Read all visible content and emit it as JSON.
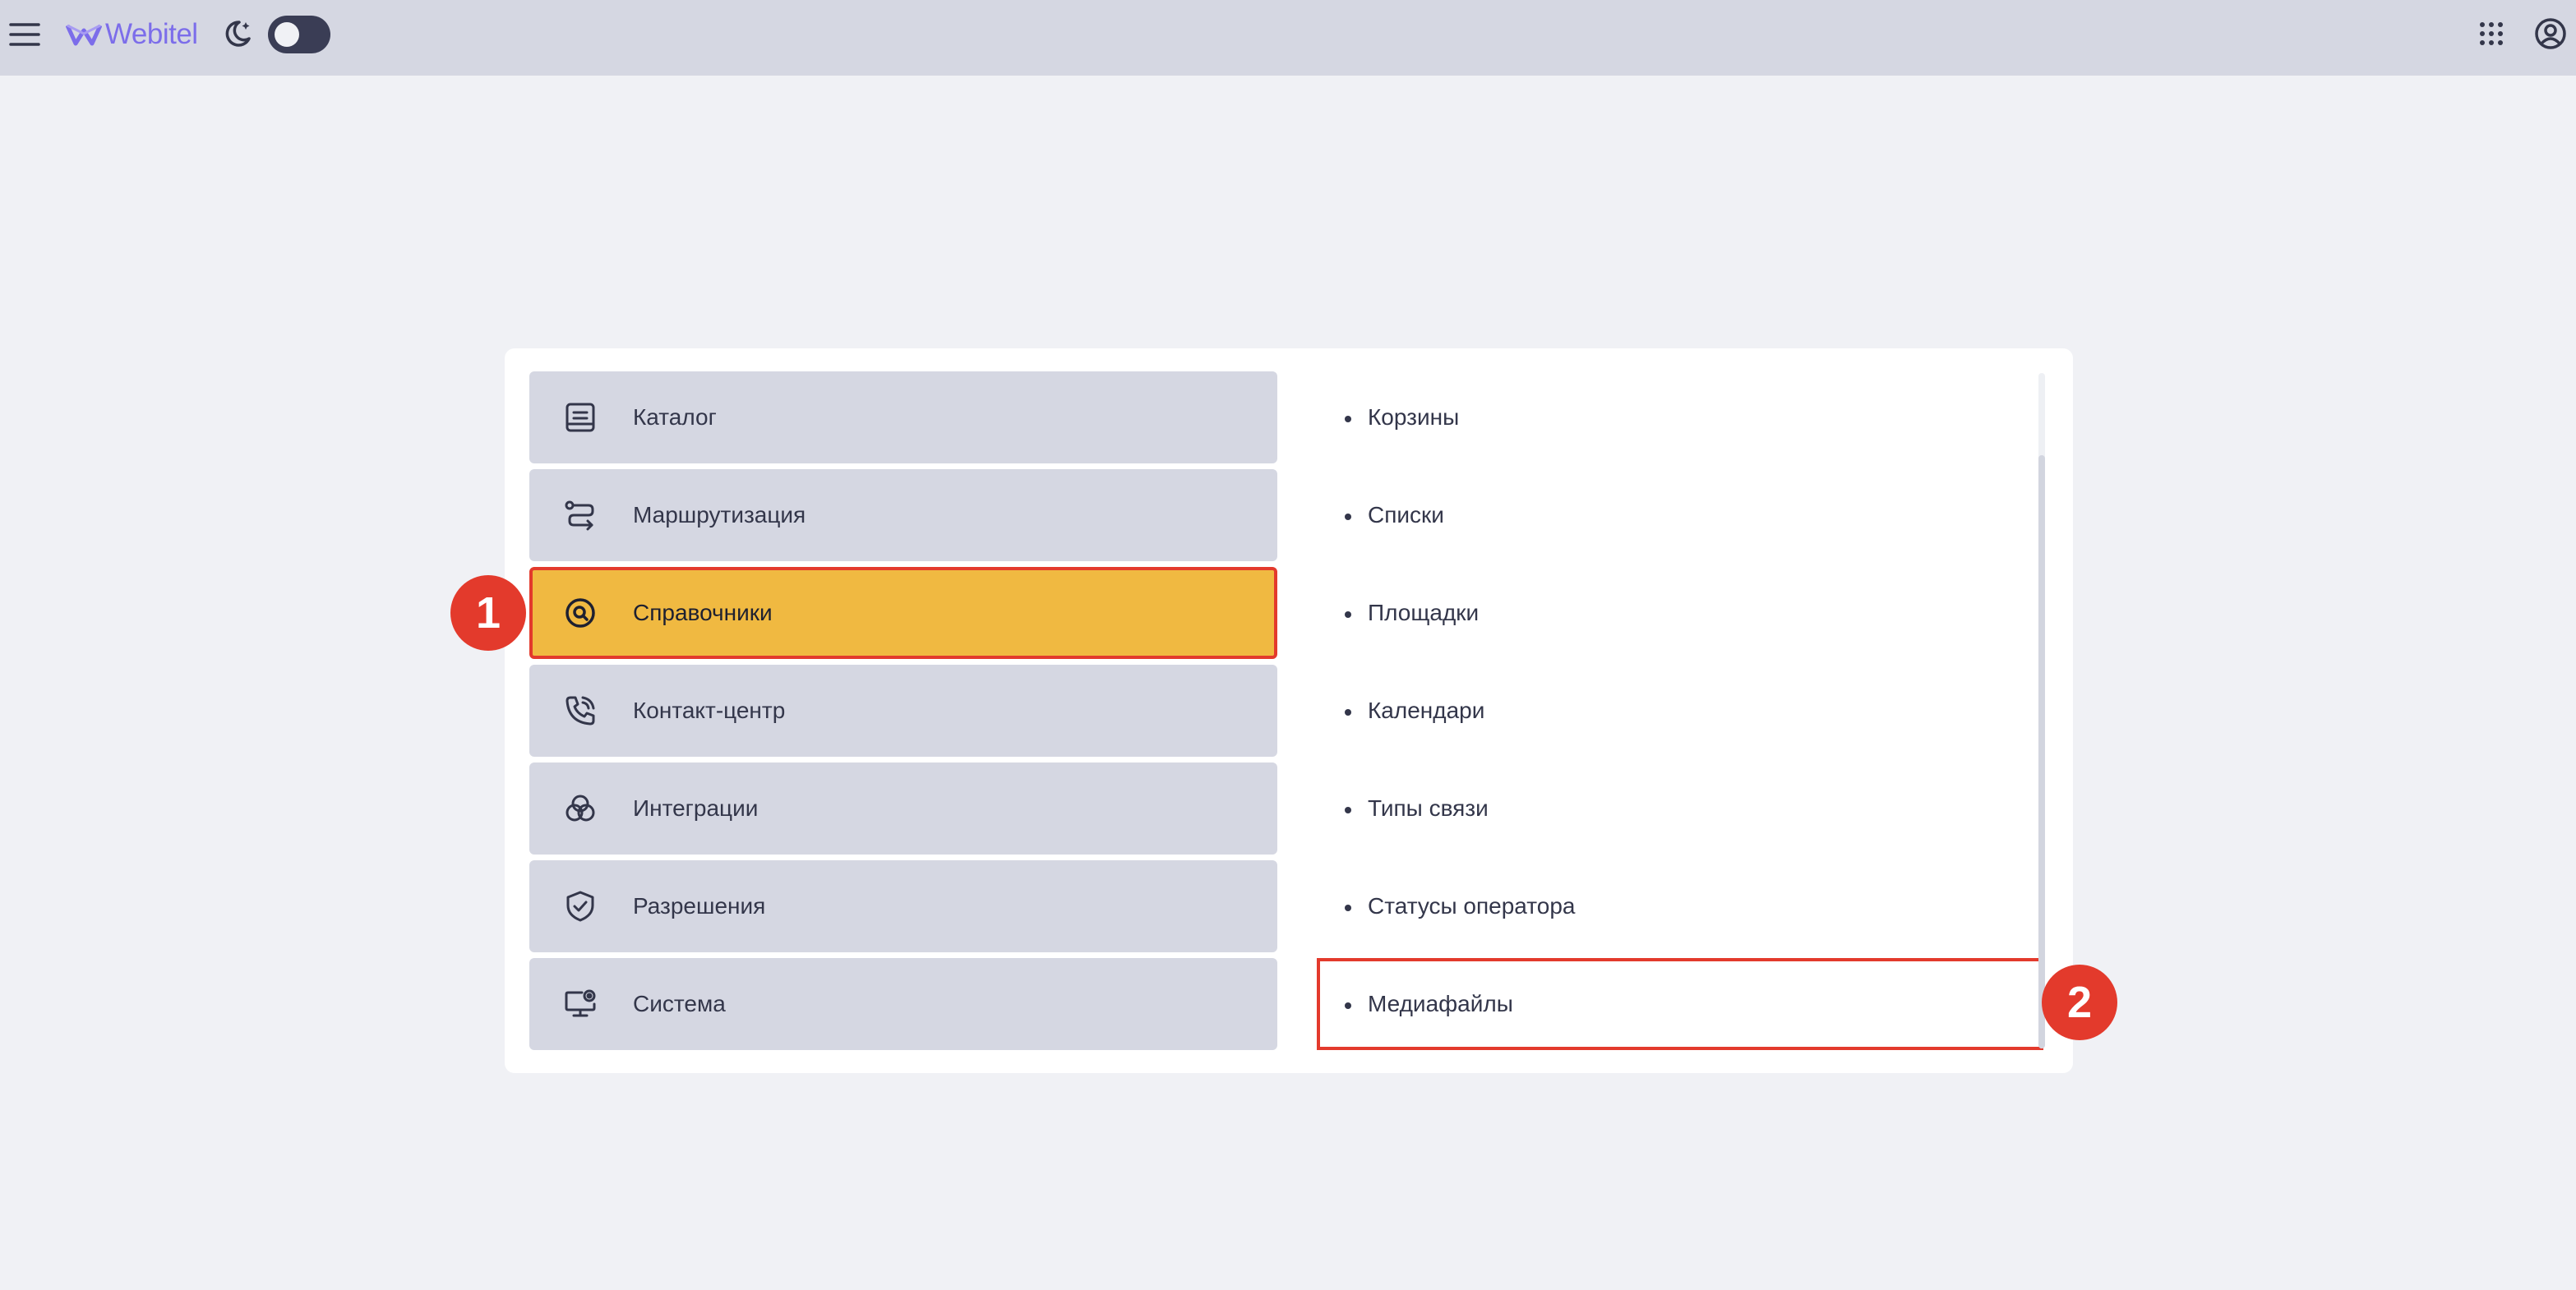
{
  "header": {
    "logo_text": "Webitel",
    "icons": {
      "menu": "hamburger-menu-icon",
      "theme": "moon-stars-icon",
      "apps": "apps-grid-icon",
      "account": "account-circle-icon"
    },
    "theme_toggle_on": false
  },
  "nav": {
    "items": [
      {
        "label": "Каталог",
        "icon": "catalog-icon",
        "active": false
      },
      {
        "label": "Маршрутизация",
        "icon": "routing-icon",
        "active": false
      },
      {
        "label": "Справочники",
        "icon": "directory-search-icon",
        "active": true
      },
      {
        "label": "Контакт-центр",
        "icon": "phone-call-icon",
        "active": false
      },
      {
        "label": "Интеграции",
        "icon": "integrations-icon",
        "active": false
      },
      {
        "label": "Разрешения",
        "icon": "shield-check-icon",
        "active": false
      },
      {
        "label": "Система",
        "icon": "system-monitor-icon",
        "active": false
      }
    ]
  },
  "subnav": {
    "items": [
      {
        "label": "Корзины"
      },
      {
        "label": "Списки"
      },
      {
        "label": "Площадки"
      },
      {
        "label": "Календари"
      },
      {
        "label": "Типы связи"
      },
      {
        "label": "Статусы оператора"
      },
      {
        "label": "Медиафайлы",
        "highlighted": true
      }
    ]
  },
  "annotations": {
    "marker_1": "1",
    "marker_2": "2",
    "color": "#e33a2c"
  },
  "colors": {
    "accent_active": "#f0b941",
    "nav_bg": "#d5d7e2",
    "brand": "#7c6dea"
  }
}
